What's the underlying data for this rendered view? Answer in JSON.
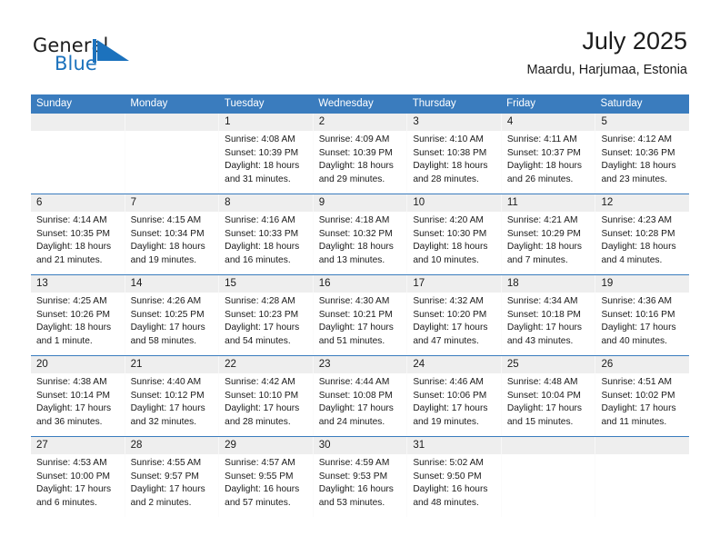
{
  "brand": {
    "name_part1": "General",
    "name_part2": "Blue",
    "accent_color": "#1c72bd"
  },
  "header": {
    "title": "July 2025",
    "subtitle": "Maardu, Harjumaa, Estonia"
  },
  "theme": {
    "header_blue": "#3a7cbe",
    "date_band_gray": "#eeeeee",
    "text_color": "#1a1a1a"
  },
  "weekdays": [
    "Sunday",
    "Monday",
    "Tuesday",
    "Wednesday",
    "Thursday",
    "Friday",
    "Saturday"
  ],
  "weeks": [
    {
      "days": [
        {
          "date": "",
          "lines": [
            "",
            "",
            "",
            ""
          ]
        },
        {
          "date": "",
          "lines": [
            "",
            "",
            "",
            ""
          ]
        },
        {
          "date": "1",
          "lines": [
            "Sunrise: 4:08 AM",
            "Sunset: 10:39 PM",
            "Daylight: 18 hours",
            "and 31 minutes."
          ]
        },
        {
          "date": "2",
          "lines": [
            "Sunrise: 4:09 AM",
            "Sunset: 10:39 PM",
            "Daylight: 18 hours",
            "and 29 minutes."
          ]
        },
        {
          "date": "3",
          "lines": [
            "Sunrise: 4:10 AM",
            "Sunset: 10:38 PM",
            "Daylight: 18 hours",
            "and 28 minutes."
          ]
        },
        {
          "date": "4",
          "lines": [
            "Sunrise: 4:11 AM",
            "Sunset: 10:37 PM",
            "Daylight: 18 hours",
            "and 26 minutes."
          ]
        },
        {
          "date": "5",
          "lines": [
            "Sunrise: 4:12 AM",
            "Sunset: 10:36 PM",
            "Daylight: 18 hours",
            "and 23 minutes."
          ]
        }
      ]
    },
    {
      "days": [
        {
          "date": "6",
          "lines": [
            "Sunrise: 4:14 AM",
            "Sunset: 10:35 PM",
            "Daylight: 18 hours",
            "and 21 minutes."
          ]
        },
        {
          "date": "7",
          "lines": [
            "Sunrise: 4:15 AM",
            "Sunset: 10:34 PM",
            "Daylight: 18 hours",
            "and 19 minutes."
          ]
        },
        {
          "date": "8",
          "lines": [
            "Sunrise: 4:16 AM",
            "Sunset: 10:33 PM",
            "Daylight: 18 hours",
            "and 16 minutes."
          ]
        },
        {
          "date": "9",
          "lines": [
            "Sunrise: 4:18 AM",
            "Sunset: 10:32 PM",
            "Daylight: 18 hours",
            "and 13 minutes."
          ]
        },
        {
          "date": "10",
          "lines": [
            "Sunrise: 4:20 AM",
            "Sunset: 10:30 PM",
            "Daylight: 18 hours",
            "and 10 minutes."
          ]
        },
        {
          "date": "11",
          "lines": [
            "Sunrise: 4:21 AM",
            "Sunset: 10:29 PM",
            "Daylight: 18 hours",
            "and 7 minutes."
          ]
        },
        {
          "date": "12",
          "lines": [
            "Sunrise: 4:23 AM",
            "Sunset: 10:28 PM",
            "Daylight: 18 hours",
            "and 4 minutes."
          ]
        }
      ]
    },
    {
      "days": [
        {
          "date": "13",
          "lines": [
            "Sunrise: 4:25 AM",
            "Sunset: 10:26 PM",
            "Daylight: 18 hours",
            "and 1 minute."
          ]
        },
        {
          "date": "14",
          "lines": [
            "Sunrise: 4:26 AM",
            "Sunset: 10:25 PM",
            "Daylight: 17 hours",
            "and 58 minutes."
          ]
        },
        {
          "date": "15",
          "lines": [
            "Sunrise: 4:28 AM",
            "Sunset: 10:23 PM",
            "Daylight: 17 hours",
            "and 54 minutes."
          ]
        },
        {
          "date": "16",
          "lines": [
            "Sunrise: 4:30 AM",
            "Sunset: 10:21 PM",
            "Daylight: 17 hours",
            "and 51 minutes."
          ]
        },
        {
          "date": "17",
          "lines": [
            "Sunrise: 4:32 AM",
            "Sunset: 10:20 PM",
            "Daylight: 17 hours",
            "and 47 minutes."
          ]
        },
        {
          "date": "18",
          "lines": [
            "Sunrise: 4:34 AM",
            "Sunset: 10:18 PM",
            "Daylight: 17 hours",
            "and 43 minutes."
          ]
        },
        {
          "date": "19",
          "lines": [
            "Sunrise: 4:36 AM",
            "Sunset: 10:16 PM",
            "Daylight: 17 hours",
            "and 40 minutes."
          ]
        }
      ]
    },
    {
      "days": [
        {
          "date": "20",
          "lines": [
            "Sunrise: 4:38 AM",
            "Sunset: 10:14 PM",
            "Daylight: 17 hours",
            "and 36 minutes."
          ]
        },
        {
          "date": "21",
          "lines": [
            "Sunrise: 4:40 AM",
            "Sunset: 10:12 PM",
            "Daylight: 17 hours",
            "and 32 minutes."
          ]
        },
        {
          "date": "22",
          "lines": [
            "Sunrise: 4:42 AM",
            "Sunset: 10:10 PM",
            "Daylight: 17 hours",
            "and 28 minutes."
          ]
        },
        {
          "date": "23",
          "lines": [
            "Sunrise: 4:44 AM",
            "Sunset: 10:08 PM",
            "Daylight: 17 hours",
            "and 24 minutes."
          ]
        },
        {
          "date": "24",
          "lines": [
            "Sunrise: 4:46 AM",
            "Sunset: 10:06 PM",
            "Daylight: 17 hours",
            "and 19 minutes."
          ]
        },
        {
          "date": "25",
          "lines": [
            "Sunrise: 4:48 AM",
            "Sunset: 10:04 PM",
            "Daylight: 17 hours",
            "and 15 minutes."
          ]
        },
        {
          "date": "26",
          "lines": [
            "Sunrise: 4:51 AM",
            "Sunset: 10:02 PM",
            "Daylight: 17 hours",
            "and 11 minutes."
          ]
        }
      ]
    },
    {
      "days": [
        {
          "date": "27",
          "lines": [
            "Sunrise: 4:53 AM",
            "Sunset: 10:00 PM",
            "Daylight: 17 hours",
            "and 6 minutes."
          ]
        },
        {
          "date": "28",
          "lines": [
            "Sunrise: 4:55 AM",
            "Sunset: 9:57 PM",
            "Daylight: 17 hours",
            "and 2 minutes."
          ]
        },
        {
          "date": "29",
          "lines": [
            "Sunrise: 4:57 AM",
            "Sunset: 9:55 PM",
            "Daylight: 16 hours",
            "and 57 minutes."
          ]
        },
        {
          "date": "30",
          "lines": [
            "Sunrise: 4:59 AM",
            "Sunset: 9:53 PM",
            "Daylight: 16 hours",
            "and 53 minutes."
          ]
        },
        {
          "date": "31",
          "lines": [
            "Sunrise: 5:02 AM",
            "Sunset: 9:50 PM",
            "Daylight: 16 hours",
            "and 48 minutes."
          ]
        },
        {
          "date": "",
          "lines": [
            "",
            "",
            "",
            ""
          ]
        },
        {
          "date": "",
          "lines": [
            "",
            "",
            "",
            ""
          ]
        }
      ]
    }
  ]
}
